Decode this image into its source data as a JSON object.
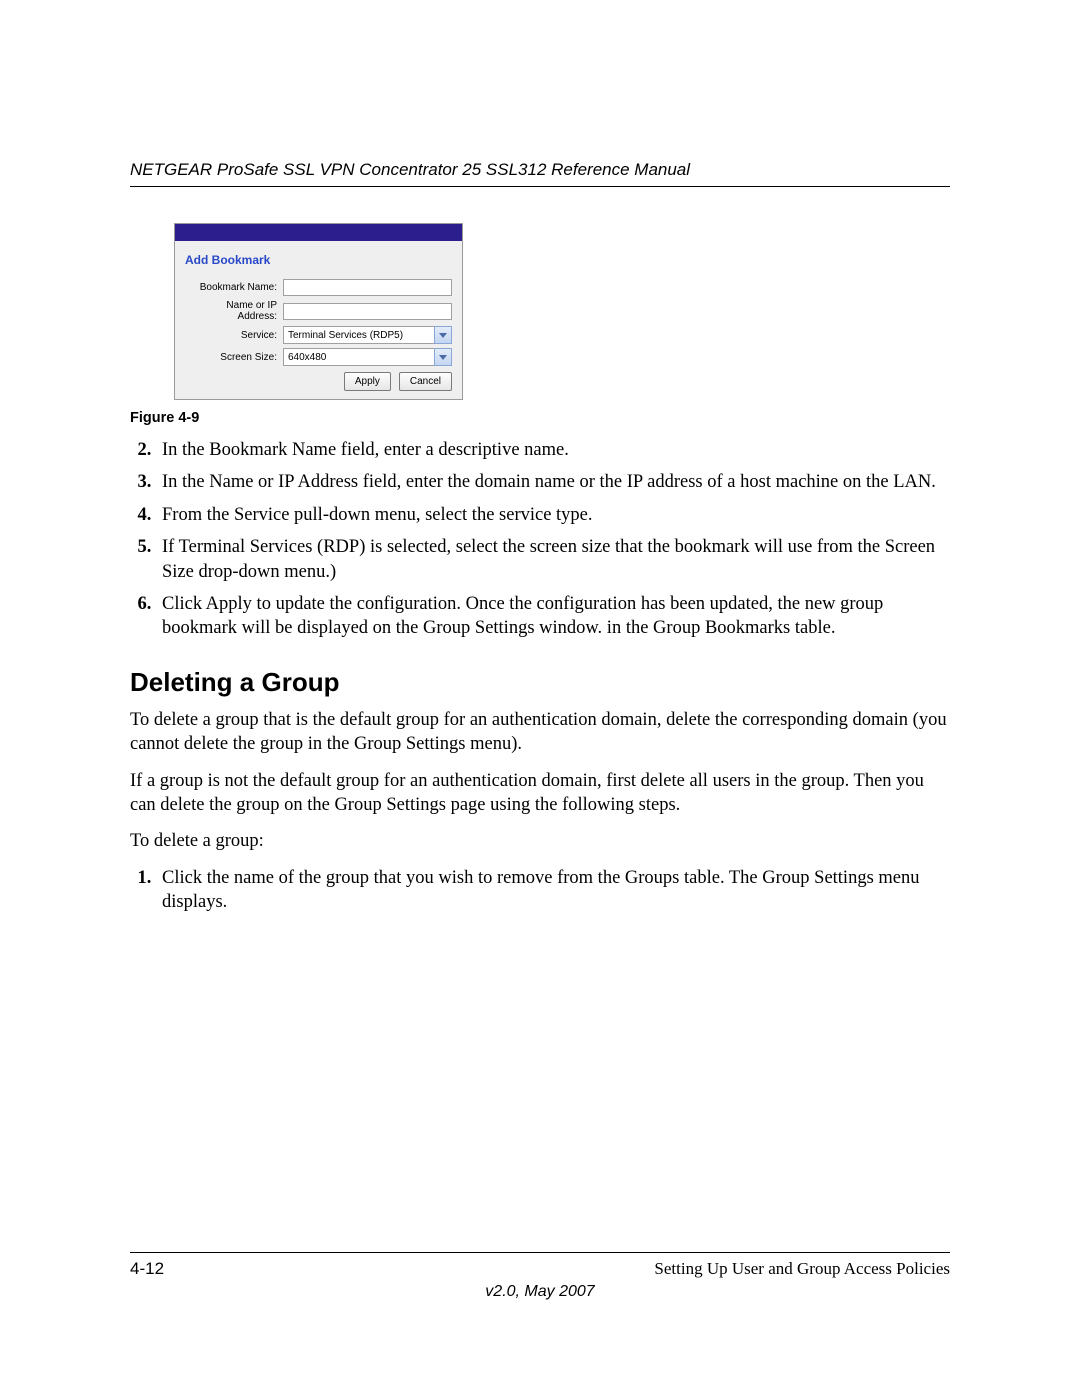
{
  "header": {
    "running_head": "NETGEAR ProSafe SSL VPN Concentrator 25 SSL312 Reference Manual"
  },
  "figure": {
    "panel_title": "Add Bookmark",
    "rows": {
      "bookmark_name": {
        "label": "Bookmark Name:",
        "value": ""
      },
      "name_ip": {
        "label": "Name or IP Address:",
        "value": ""
      },
      "service": {
        "label": "Service:",
        "value": "Terminal Services (RDP5)"
      },
      "screen_size": {
        "label": "Screen Size:",
        "value": "640x480"
      }
    },
    "buttons": {
      "apply": "Apply",
      "cancel": "Cancel"
    },
    "caption": "Figure 4-9"
  },
  "steps_a": {
    "start": 2,
    "items": [
      "In the Bookmark Name field, enter a descriptive name.",
      "In the Name or IP Address field, enter the domain name or the IP address of a host machine on the LAN.",
      "From the Service pull-down menu, select the service type.",
      "If Terminal Services (RDP) is selected, select the screen size that the bookmark will use from the Screen Size drop-down menu.)",
      "Click Apply to update the configuration. Once the configuration has been updated, the new group bookmark will be displayed on the Group Settings window. in the Group Bookmarks table."
    ]
  },
  "section": {
    "title": "Deleting a Group",
    "p1": "To delete a group that is the default group for an authentication domain, delete the corresponding domain (you cannot delete the group in the Group Settings menu).",
    "p2": "If a group is not the default group for an authentication domain, first delete all users in the group. Then you can delete the group on the Group Settings page using the following steps.",
    "p3": "To delete a group:"
  },
  "steps_b": {
    "start": 1,
    "items": [
      "Click the name of the group that you wish to remove from the Groups table. The Group Settings menu displays."
    ]
  },
  "footer": {
    "page_num": "4-12",
    "section_title": "Setting Up User and Group Access Policies",
    "version": "v2.0, May 2007"
  }
}
